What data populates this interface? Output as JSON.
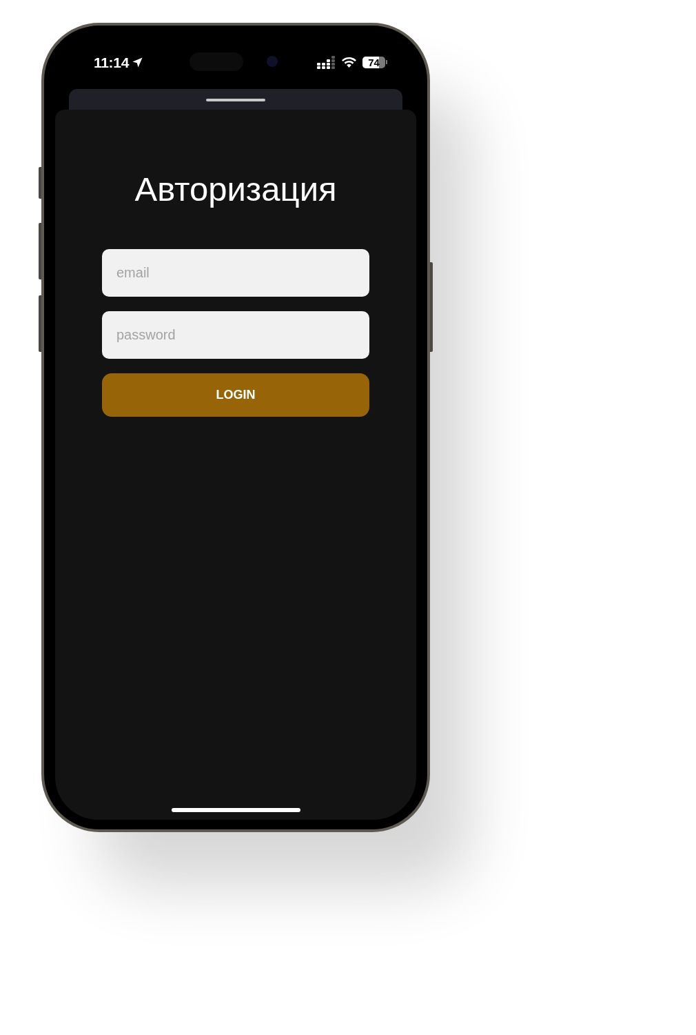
{
  "status_bar": {
    "time": "11:14",
    "battery": {
      "percent": "74",
      "level": 0.74
    }
  },
  "sheet": {
    "title": "Авторизация",
    "fields": [
      {
        "placeholder": "email"
      },
      {
        "placeholder": "password"
      }
    ],
    "login_button": {
      "label": "LOGIN"
    }
  }
}
